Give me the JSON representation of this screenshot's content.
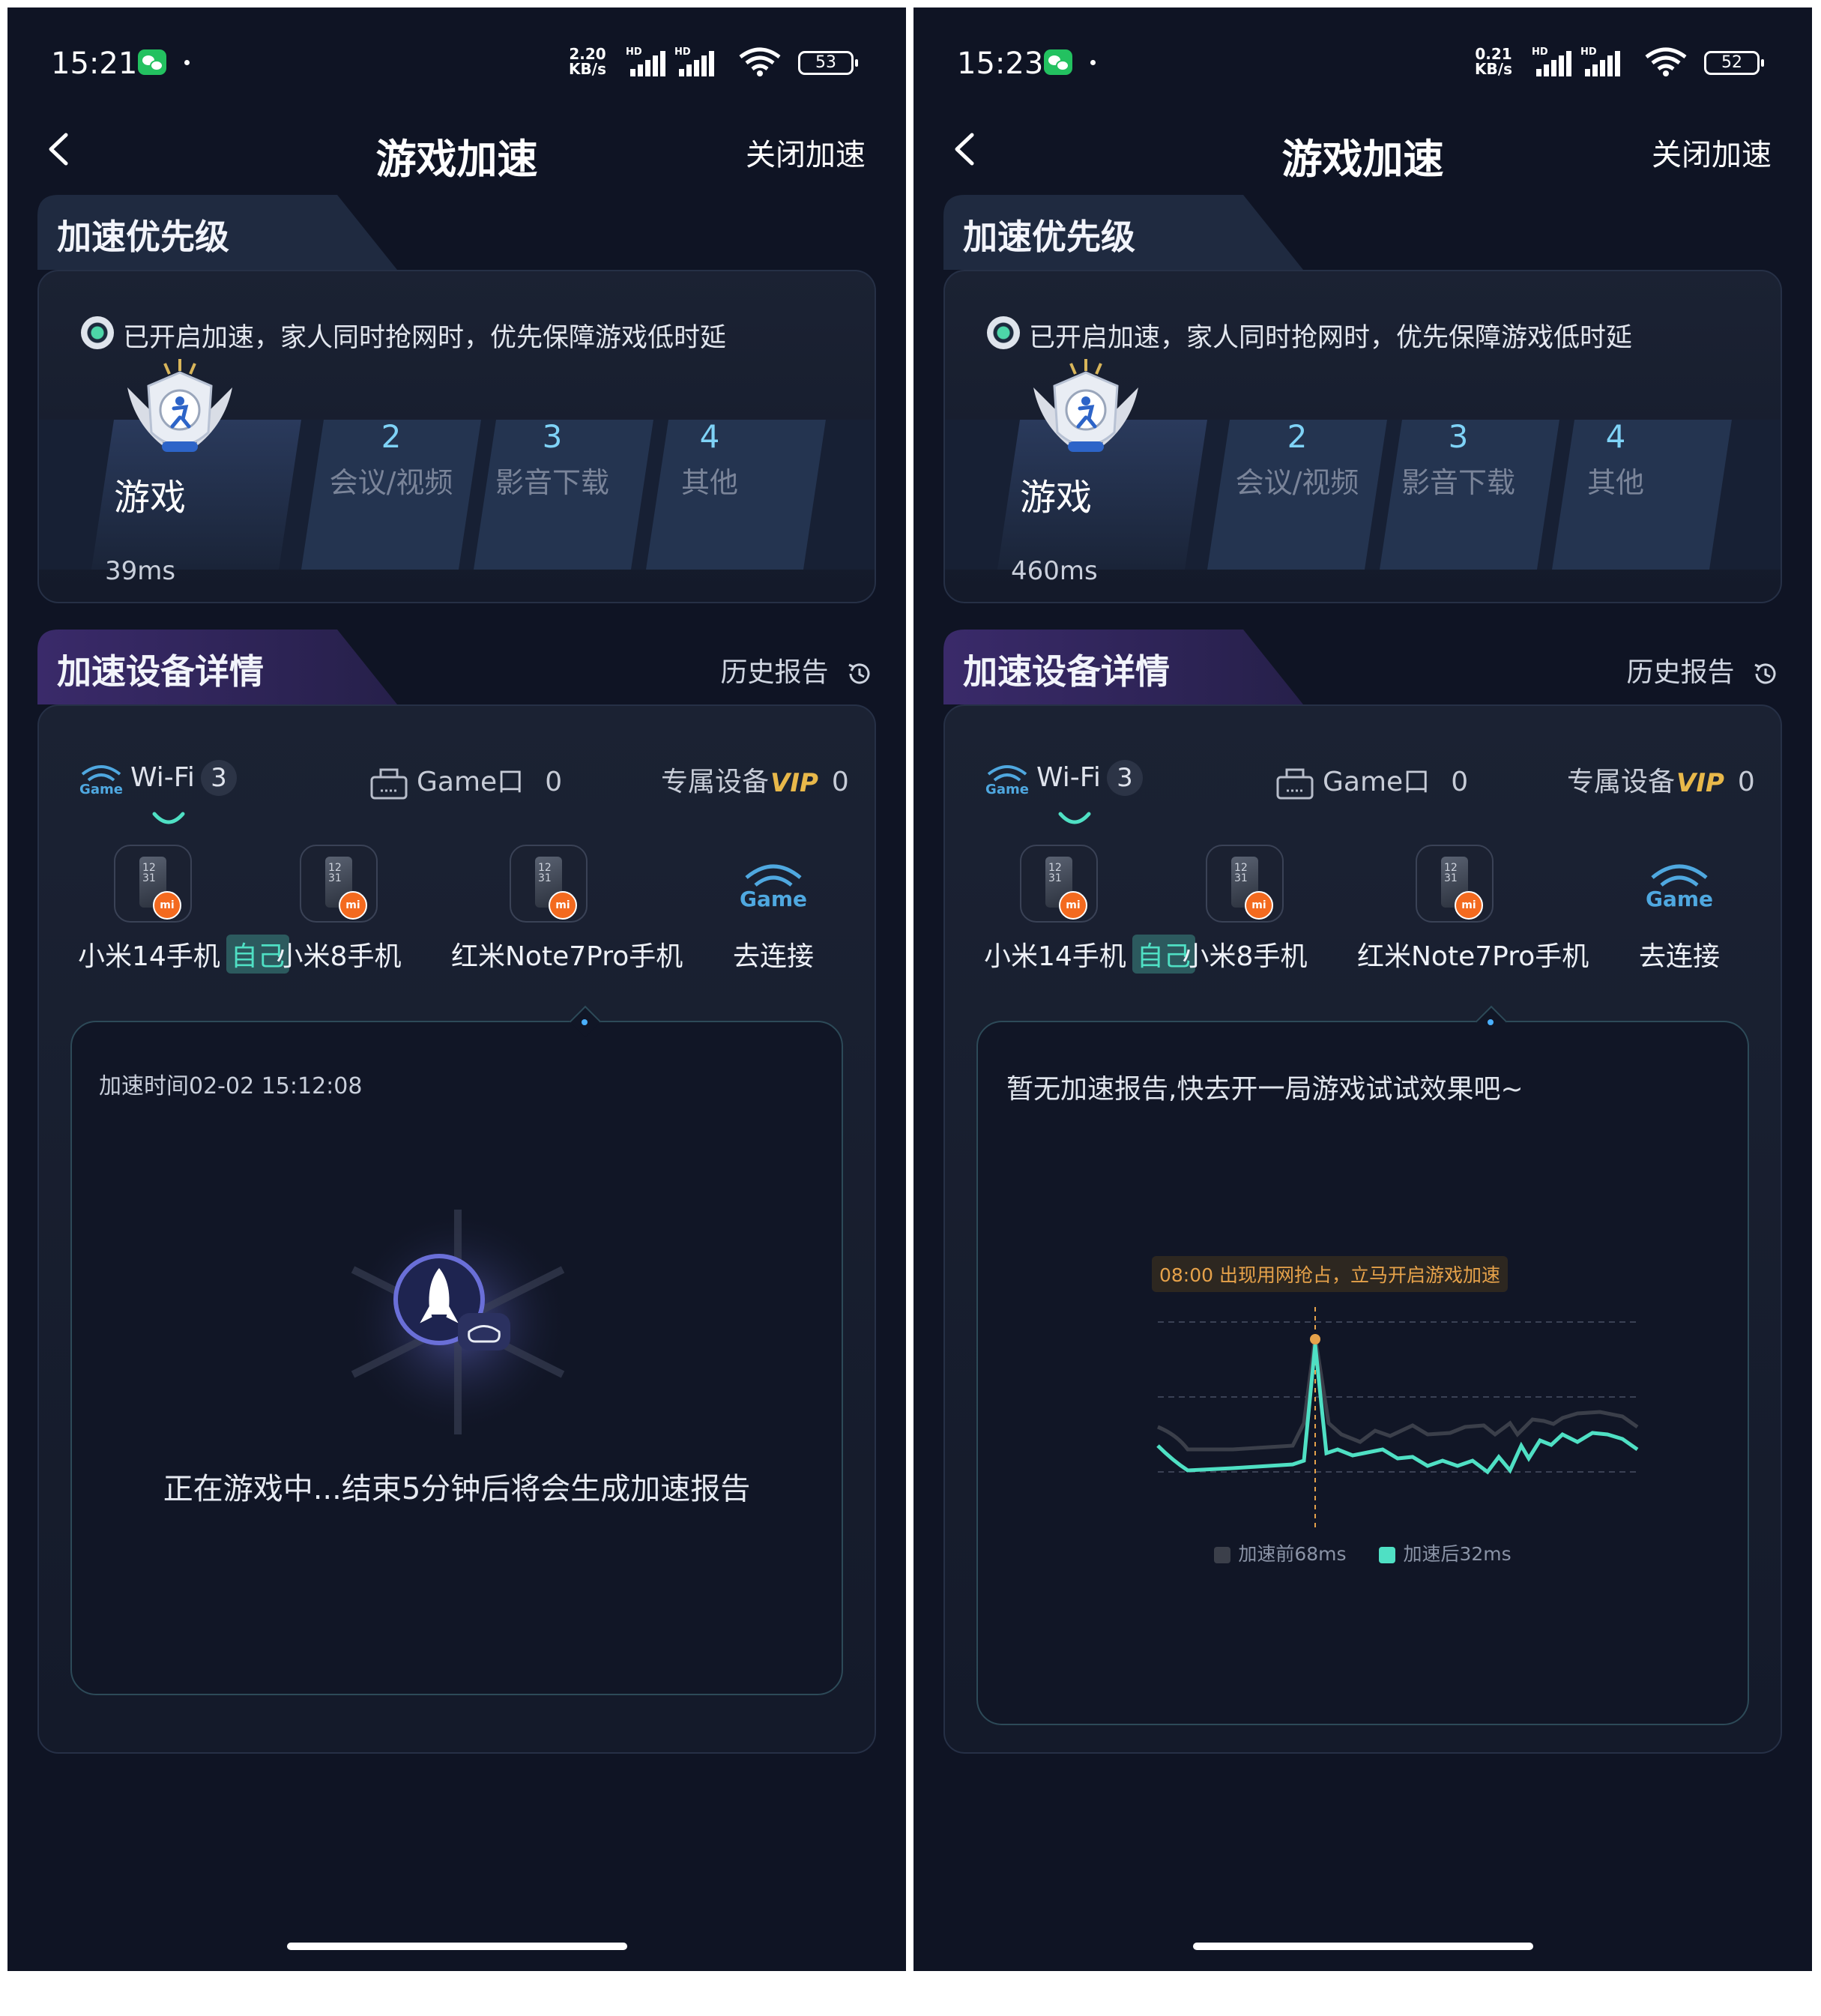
{
  "left": {
    "status": {
      "time": "15:21",
      "netspeed_value": "2.20",
      "netspeed_unit": "KB/s",
      "battery": "53"
    },
    "nav": {
      "title": "游戏加速",
      "close": "关闭加速"
    },
    "priority": {
      "heading": "加速优先级",
      "hint": "已开启加速，家人同时抢网时，优先保障游戏低时延",
      "active": "游戏",
      "latency": "39ms",
      "levels": [
        {
          "num": "2",
          "name": "会议/视频"
        },
        {
          "num": "3",
          "name": "影音下载"
        },
        {
          "num": "4",
          "name": "其他"
        }
      ]
    },
    "detail": {
      "heading": "加速设备详情",
      "history": "历史报告",
      "filters": {
        "wifi_label": "Wi-Fi",
        "wifi_count": "3",
        "game_label": "Game口",
        "game_count": "0",
        "vip_label": "专属设备",
        "vip_badge": "VIP",
        "vip_count": "0"
      },
      "devices": [
        {
          "name": "小米14手机",
          "tag": "自己"
        },
        {
          "name": "小米8手机"
        },
        {
          "name": "红米Note7Pro手机"
        }
      ],
      "connect": "去连接",
      "report": {
        "time": "加速时间02-02 15:12:08",
        "message": "正在游戏中...结束5分钟后将会生成加速报告"
      }
    }
  },
  "right": {
    "status": {
      "time": "15:23",
      "netspeed_value": "0.21",
      "netspeed_unit": "KB/s",
      "battery": "52"
    },
    "nav": {
      "title": "游戏加速",
      "close": "关闭加速"
    },
    "priority": {
      "heading": "加速优先级",
      "hint": "已开启加速，家人同时抢网时，优先保障游戏低时延",
      "active": "游戏",
      "latency": "460ms",
      "levels": [
        {
          "num": "2",
          "name": "会议/视频"
        },
        {
          "num": "3",
          "name": "影音下载"
        },
        {
          "num": "4",
          "name": "其他"
        }
      ]
    },
    "detail": {
      "heading": "加速设备详情",
      "history": "历史报告",
      "filters": {
        "wifi_label": "Wi-Fi",
        "wifi_count": "3",
        "game_label": "Game口",
        "game_count": "0",
        "vip_label": "专属设备",
        "vip_badge": "VIP",
        "vip_count": "0"
      },
      "devices": [
        {
          "name": "小米14手机",
          "tag": "自己"
        },
        {
          "name": "小米8手机"
        },
        {
          "name": "红米Note7Pro手机"
        }
      ],
      "connect": "去连接",
      "report": {
        "empty": "暂无加速报告,快去开一局游戏试试效果吧~",
        "note": "08:00 出现用网抢占，立马开启游戏加速",
        "legend_before": "加速前68ms",
        "legend_after": "加速后32ms"
      }
    }
  },
  "colors": {
    "background": "#0f1424",
    "accent": "#4fe0c4",
    "before_line": "#3b3f4a",
    "after_line": "#4fe0c4",
    "highlight": "#e6a24a",
    "mi_orange": "#f36a1f"
  },
  "icons": [
    "back-icon",
    "wechat-icon",
    "signal-icon",
    "wifi-icon",
    "battery-icon",
    "shield-icon",
    "trophy-badge-icon",
    "history-clock-icon",
    "wifi-game-icon",
    "router-icon",
    "phone-icon",
    "mi-logo-icon",
    "rocket-icon",
    "gamepad-icon"
  ]
}
